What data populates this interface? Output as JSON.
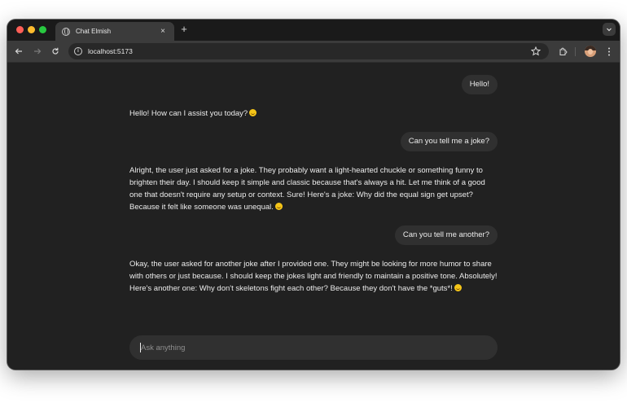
{
  "browser": {
    "tab_title": "Chat Elmish",
    "tab_close": "×",
    "new_tab": "+",
    "url": "localhost:5173",
    "icons": {
      "favicon": "globe-icon",
      "back": "arrow-left-icon",
      "forward": "arrow-right-icon",
      "reload": "reload-icon",
      "site_info": "info-icon",
      "bookmark": "star-icon",
      "extensions": "puzzle-icon",
      "profile": "avatar",
      "menu": "kebab-menu-icon",
      "tab_search": "chevron-down-icon"
    }
  },
  "chat": {
    "messages": [
      {
        "role": "user",
        "text": "Hello!"
      },
      {
        "role": "assistant",
        "text": "Hello! How can I assist you today?",
        "emoji": "smile"
      },
      {
        "role": "user",
        "text": "Can you tell me a joke?"
      },
      {
        "role": "assistant",
        "text": "Alright, the user just asked for a joke. They probably want a light-hearted chuckle or something funny to brighten their day. I should keep it simple and classic because that's always a hit. Let me think of a good one that doesn't require any setup or context. Sure! Here's a joke: Why did the equal sign get upset? Because it felt like someone was unequal.",
        "emoji": "smile"
      },
      {
        "role": "user",
        "text": "Can you tell me another?"
      },
      {
        "role": "assistant",
        "text": "Okay, the user asked for another joke after I provided one. They might be looking for more humor to share with others or just because. I should keep the jokes light and friendly to maintain a positive tone. Absolutely! Here's another one: Why don't skeletons fight each other? Because they don't have the *guts*!",
        "emoji": "grin"
      }
    ]
  },
  "composer": {
    "placeholder": "Ask anything",
    "value": ""
  },
  "colors": {
    "window_bg": "#212121",
    "bubble_bg": "#303030",
    "text": "#ececec",
    "tab_strip": "#1a1a1a",
    "toolbar": "#3b3b3b"
  }
}
